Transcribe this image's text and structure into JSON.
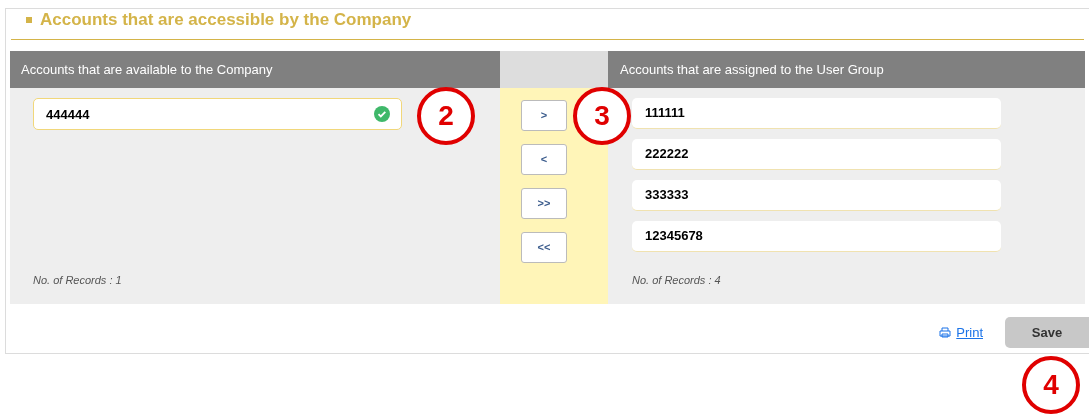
{
  "section": {
    "title": "Accounts that are accessible by the Company"
  },
  "available": {
    "header": "Accounts that are available to the Company",
    "search": {
      "value": "444444",
      "valid": true
    },
    "records": "No. of Records : 1"
  },
  "move_buttons": [
    ">",
    "<",
    ">>",
    "<<"
  ],
  "assigned": {
    "header": "Accounts that are assigned to the User Group",
    "items": [
      "111111",
      "222222",
      "333333",
      "12345678"
    ],
    "records": "No. of Records : 4"
  },
  "footer": {
    "print": "Print",
    "save": "Save"
  },
  "callouts": [
    "2",
    "3",
    "4"
  ]
}
